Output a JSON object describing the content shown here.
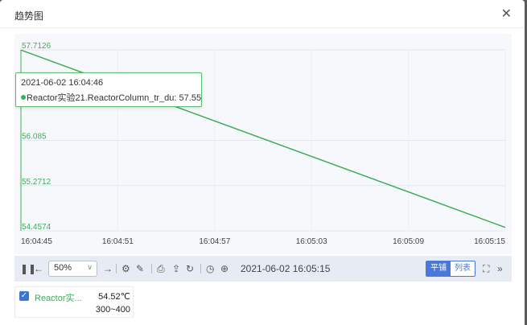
{
  "dialog": {
    "title": "趋势图",
    "close_icon": "close-icon"
  },
  "chart_data": {
    "type": "line",
    "x_ticks": [
      "16:04:45",
      "16:04:51",
      "16:04:57",
      "16:05:03",
      "16:05:09",
      "16:05:15"
    ],
    "y_ticks": [
      "57.7126",
      "56.085",
      "55.2712",
      "54.4574"
    ],
    "ylim": [
      54.4574,
      57.7126
    ],
    "series": [
      {
        "name": "Reactor实验21.ReactorColumn_tr_du",
        "color": "#3dae5a",
        "x": [
          "2021-06-02 16:04:45",
          "2021-06-02 16:05:15"
        ],
        "y": [
          57.71,
          54.52
        ]
      }
    ],
    "grid": true
  },
  "tooltip": {
    "time": "2021-06-02 16:04:46",
    "label": "Reactor实验21.ReactorColumn_tr_du: 57.55"
  },
  "toolbar": {
    "zoom": "50%",
    "current_time": "2021-06-02 16:05:15",
    "mode_tile": "平铺",
    "mode_list": "列表"
  },
  "legend": {
    "name": "Reactor实...",
    "value": "54.52℃",
    "range": "300~400",
    "checked": true
  },
  "colors": {
    "accent": "#4a78d8",
    "series": "#3dae5a",
    "toolbar_bg": "#e7ebf3"
  }
}
